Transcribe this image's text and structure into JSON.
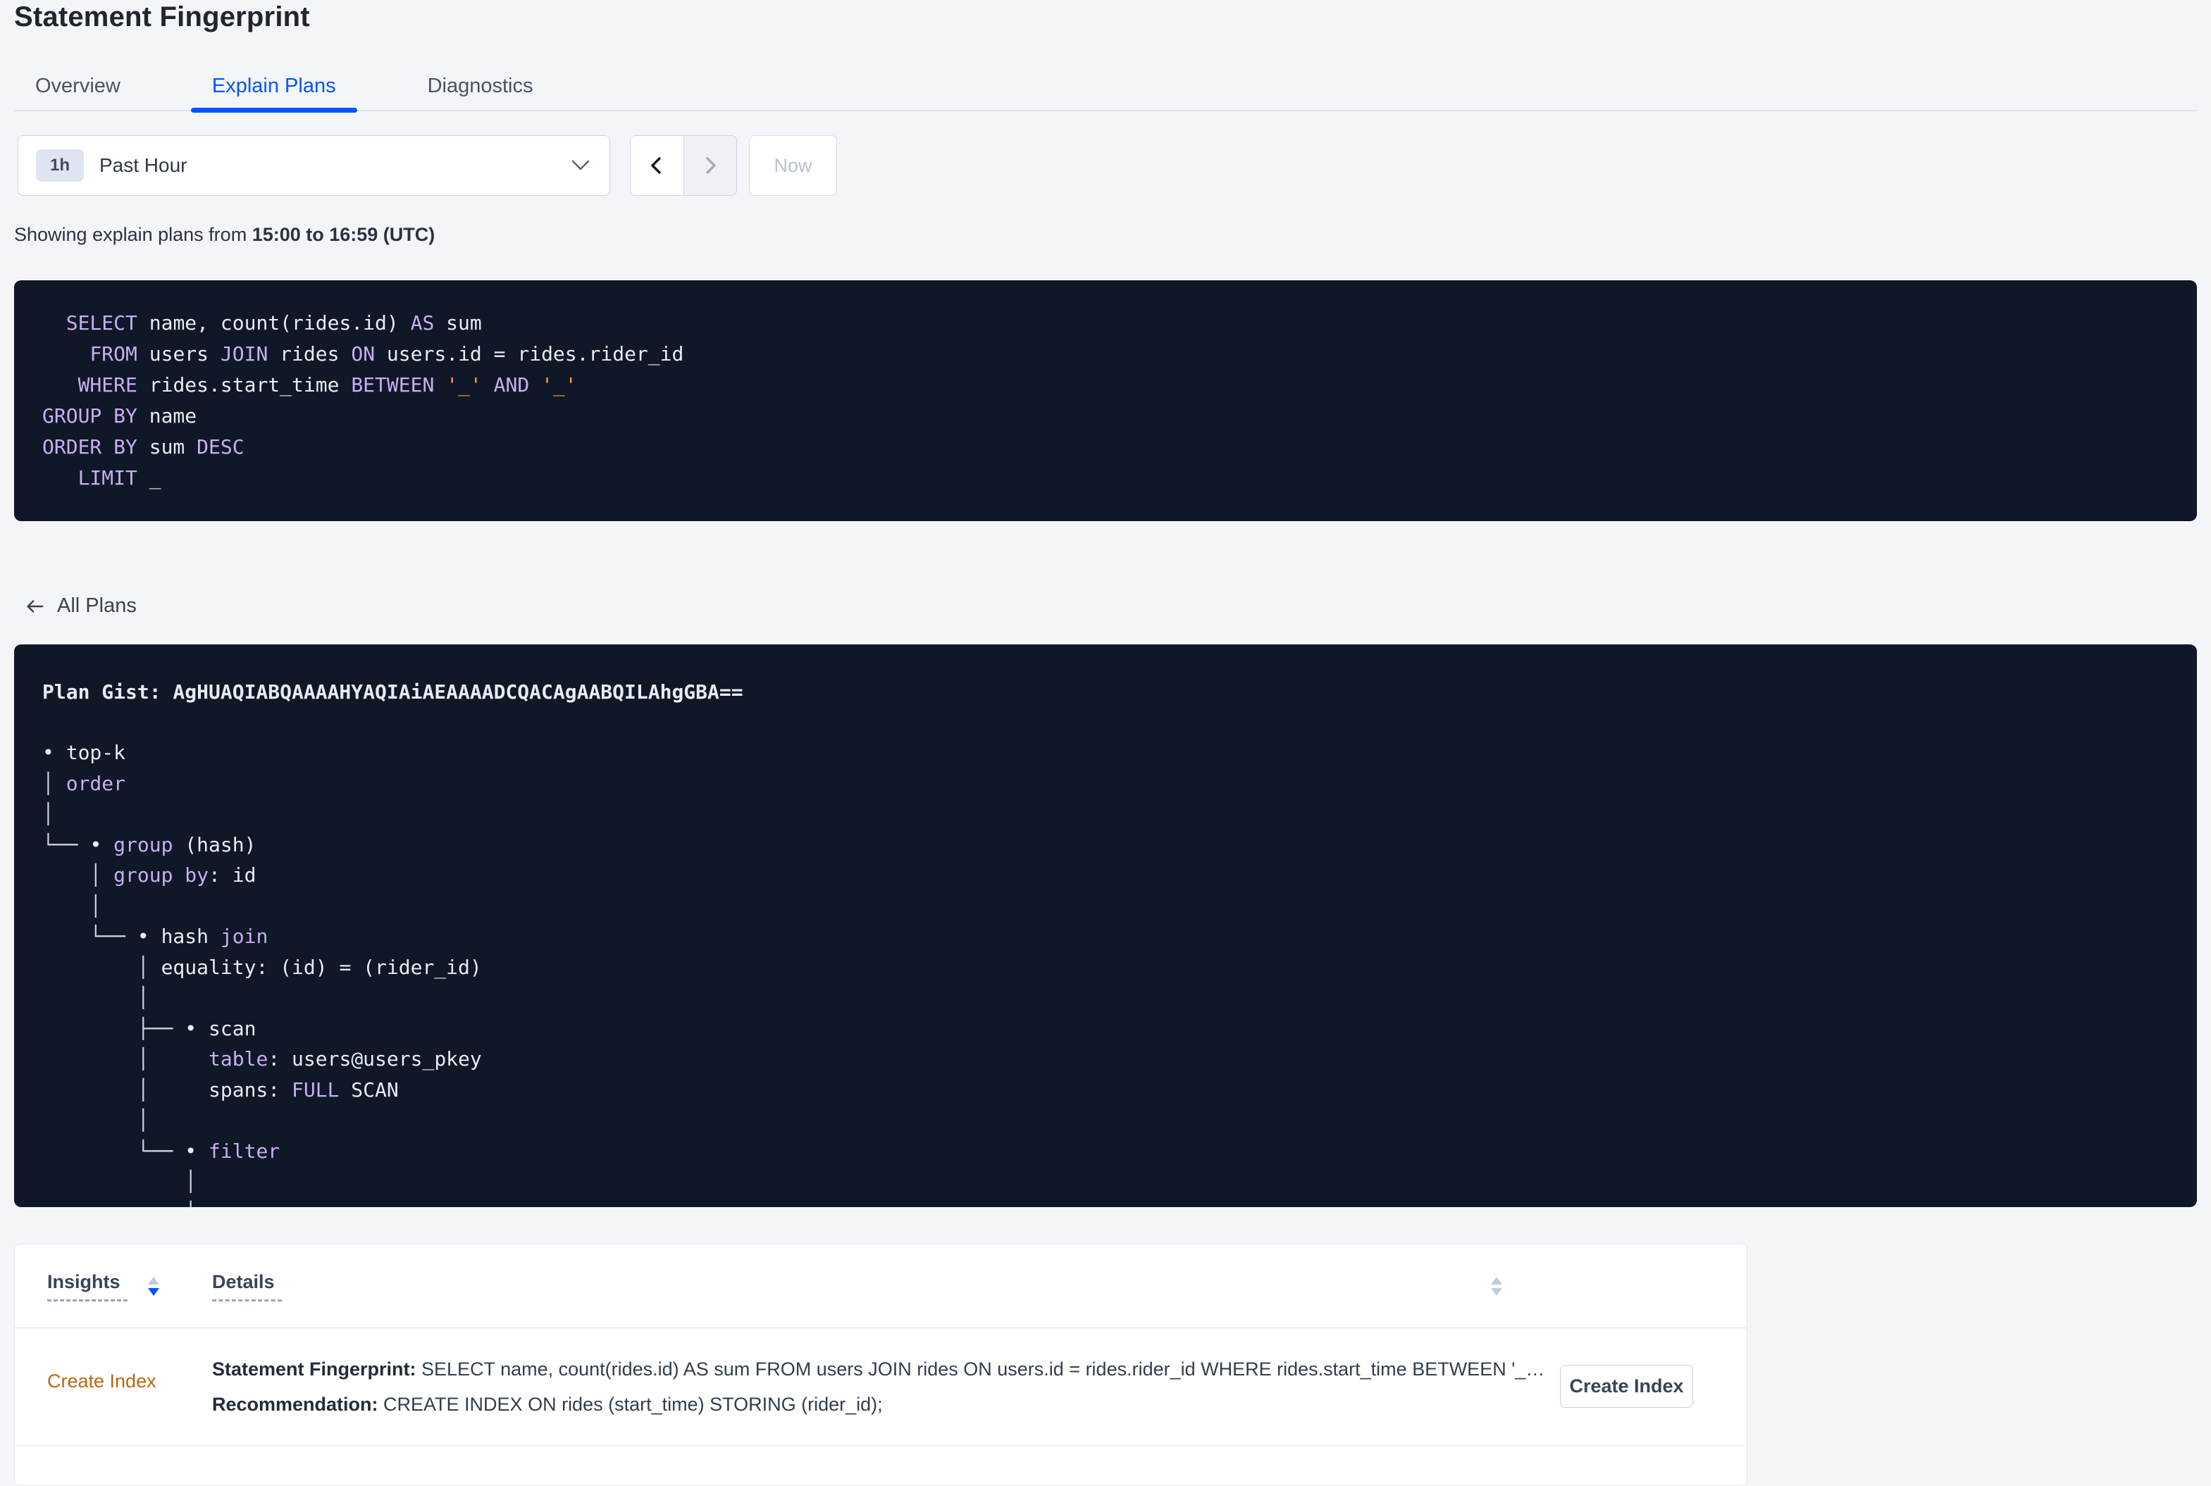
{
  "page_title": "Statement Fingerprint",
  "tabs": [
    {
      "label": "Overview",
      "active": false
    },
    {
      "label": "Explain Plans",
      "active": true
    },
    {
      "label": "Diagnostics",
      "active": false
    }
  ],
  "time_controls": {
    "interval_badge": "1h",
    "range_label": "Past Hour",
    "now_label": "Now"
  },
  "status_line": {
    "prefix": "Showing explain plans from ",
    "range": "15:00 to 16:59 (UTC)"
  },
  "sql": {
    "lines": [
      [
        {
          "t": "  "
        },
        {
          "t": "SELECT",
          "c": "kw"
        },
        {
          "t": " name, count(rides.id) "
        },
        {
          "t": "AS",
          "c": "kw"
        },
        {
          "t": " sum"
        }
      ],
      [
        {
          "t": "    "
        },
        {
          "t": "FROM",
          "c": "kw"
        },
        {
          "t": " users "
        },
        {
          "t": "JOIN",
          "c": "kw"
        },
        {
          "t": " rides "
        },
        {
          "t": "ON",
          "c": "kw"
        },
        {
          "t": " users.id = rides.rider_id"
        }
      ],
      [
        {
          "t": "   "
        },
        {
          "t": "WHERE",
          "c": "kw"
        },
        {
          "t": " rides.start_time "
        },
        {
          "t": "BETWEEN",
          "c": "kw"
        },
        {
          "t": " "
        },
        {
          "t": "'_'",
          "c": "lit"
        },
        {
          "t": " "
        },
        {
          "t": "AND",
          "c": "kw"
        },
        {
          "t": " "
        },
        {
          "t": "'_'",
          "c": "lit"
        }
      ],
      [
        {
          "t": "GROUP BY",
          "c": "kw"
        },
        {
          "t": " name"
        }
      ],
      [
        {
          "t": "ORDER BY",
          "c": "kw"
        },
        {
          "t": " sum "
        },
        {
          "t": "DESC",
          "c": "kw"
        }
      ],
      [
        {
          "t": "   "
        },
        {
          "t": "LIMIT",
          "c": "kw"
        },
        {
          "t": " _"
        }
      ]
    ]
  },
  "back_link_label": "All Plans",
  "plan": {
    "gist": "Plan Gist: AgHUAQIABQAAAAHYAQIAiAEAAAADCQACAgAABQILAhgGBA==",
    "tree": [
      [
        {
          "t": "• top-k"
        }
      ],
      [
        {
          "t": "│ ",
          "c": "ln"
        },
        {
          "t": "order",
          "c": "kw"
        }
      ],
      [
        {
          "t": "│",
          "c": "ln"
        }
      ],
      [
        {
          "t": "└── ",
          "c": "ln"
        },
        {
          "t": "• "
        },
        {
          "t": "group",
          "c": "kw"
        },
        {
          "t": " (hash)"
        }
      ],
      [
        {
          "t": "    │ ",
          "c": "ln"
        },
        {
          "t": "group by",
          "c": "kw"
        },
        {
          "t": ": id"
        }
      ],
      [
        {
          "t": "    │",
          "c": "ln"
        }
      ],
      [
        {
          "t": "    └── ",
          "c": "ln"
        },
        {
          "t": "• hash "
        },
        {
          "t": "join",
          "c": "kw"
        }
      ],
      [
        {
          "t": "        │ ",
          "c": "ln"
        },
        {
          "t": "equality: (id) = (rider_id)"
        }
      ],
      [
        {
          "t": "        │",
          "c": "ln"
        }
      ],
      [
        {
          "t": "        ├── ",
          "c": "ln"
        },
        {
          "t": "• scan"
        }
      ],
      [
        {
          "t": "        │",
          "c": "ln"
        },
        {
          "t": "     "
        },
        {
          "t": "table",
          "c": "kw"
        },
        {
          "t": ": users@users_pkey"
        }
      ],
      [
        {
          "t": "        │",
          "c": "ln"
        },
        {
          "t": "     spans: "
        },
        {
          "t": "FULL",
          "c": "kw"
        },
        {
          "t": " SCAN"
        }
      ],
      [
        {
          "t": "        │",
          "c": "ln"
        }
      ],
      [
        {
          "t": "        └── ",
          "c": "ln"
        },
        {
          "t": "• "
        },
        {
          "t": "filter",
          "c": "kw"
        }
      ],
      [
        {
          "t": "            │",
          "c": "ln"
        }
      ],
      [
        {
          "t": "            │",
          "c": "ln"
        }
      ]
    ]
  },
  "insights": {
    "columns": [
      {
        "label": "Insights",
        "sorted": "desc"
      },
      {
        "label": "Details",
        "sorted": "none"
      }
    ],
    "rows": [
      {
        "insight": "Create Index",
        "details": [
          [
            {
              "t": "Statement Fingerprint:",
              "b": true
            },
            {
              "t": " SELECT name, count(rides.id) AS sum FROM users JOIN rides ON users.id = rides.rider_id WHERE rides.start_time BETWEEN '_…"
            }
          ],
          [
            {
              "t": "Recommendation:",
              "b": true
            },
            {
              "t": " CREATE INDEX ON rides (start_time) STORING (rider_id);"
            }
          ]
        ],
        "action_label": "Create Index"
      }
    ]
  },
  "colors": {
    "accent_blue": "#0055ff",
    "code_panel_bg": "#0f1827",
    "sql_keyword": "#c9adf0",
    "sql_literal": "#f2a440",
    "sql_text": "#e9ebf3",
    "tree_line": "#ccd2e0",
    "insight_orange": "#bd6510",
    "text_dark": "#242a35",
    "text_slate": "#394455",
    "page_bg": "#f4f5f9"
  }
}
